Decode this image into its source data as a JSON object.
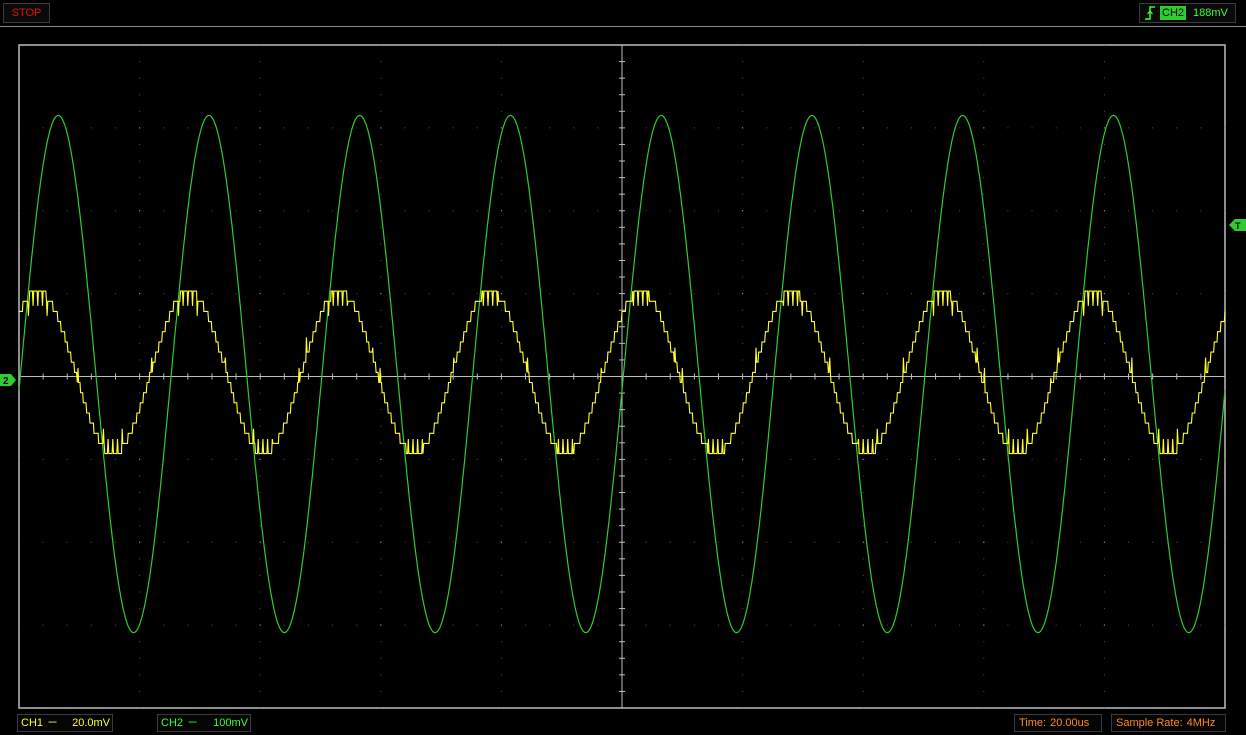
{
  "status": {
    "label": "STOP",
    "color": "#e01010"
  },
  "trigger": {
    "icon": "rising-edge-trigger-icon",
    "channel": "CH2",
    "level": "188mV",
    "marker": "T"
  },
  "markers": {
    "ch2_ground": "2"
  },
  "channels": [
    {
      "name": "CH1",
      "coupling": "DC",
      "coupling_symbol": "---",
      "scale": "20.0mV",
      "color": "#ffff33"
    },
    {
      "name": "CH2",
      "coupling": "DC",
      "coupling_symbol": "---",
      "scale": "100mV",
      "color": "#2ecc2e"
    }
  ],
  "timebase": {
    "label": "Time:",
    "value": "20.00us"
  },
  "sample_rate": {
    "label": "Sample Rate:",
    "value": "4MHz"
  },
  "orange_color": "#ff8a1e",
  "grid": {
    "horizontal_divisions": 10,
    "vertical_divisions": 8
  },
  "chart_data": {
    "type": "line",
    "x_divisions": 10,
    "y_divisions": 8,
    "x_unit": "div",
    "y_unit": "div",
    "series": [
      {
        "name": "CH2",
        "waveform": "sine",
        "color": "#2ecc2e",
        "cycles_on_screen": 8,
        "amplitude_div": 3.12,
        "offset_div": 0.03,
        "phase_at_left_cycles": -0.01
      },
      {
        "name": "CH1",
        "waveform": "stepped-sine",
        "color": "#ffff33",
        "cycles_on_screen": 8,
        "amplitude_div": 0.98,
        "offset_div": 0.05,
        "phase_at_left_cycles": 0.125,
        "quant_levels": 8
      }
    ]
  }
}
